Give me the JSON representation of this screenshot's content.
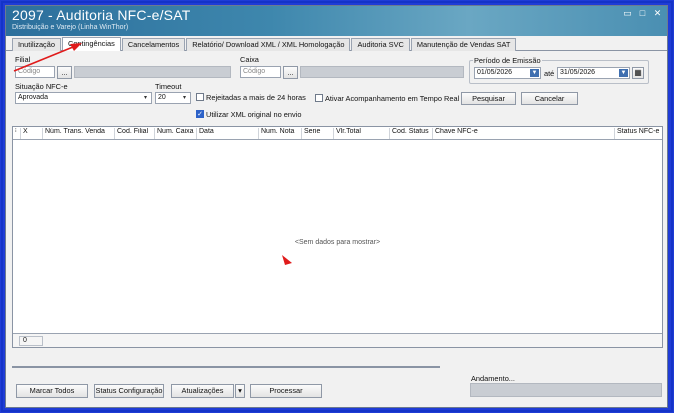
{
  "window": {
    "title": "2097 - Auditoria NFC-e/SAT",
    "subtitle": "Distribuição e Varejo (Linha WinThor)",
    "controls": [
      "restore-icon",
      "maximize-icon",
      "close-icon"
    ]
  },
  "tabs": [
    {
      "label": "Inutilização",
      "active": false
    },
    {
      "label": "Contingências",
      "active": true
    },
    {
      "label": "Cancelamentos",
      "active": false
    },
    {
      "label": "Relatório/ Download XML / XML Homologação",
      "active": false
    },
    {
      "label": "Auditoria SVC",
      "active": false
    },
    {
      "label": "Manutenção de Vendas SAT",
      "active": false
    }
  ],
  "filters": {
    "filial": {
      "label": "Filial",
      "placeholder": "Código",
      "lookup": "..."
    },
    "caixa": {
      "label": "Caixa",
      "placeholder": "Código",
      "lookup": "..."
    },
    "periodo": {
      "label": "Período de Emissão",
      "start": "01/05/2026",
      "separator": "até",
      "end": "31/05/2026",
      "calendar_icon": "calendar-icon"
    },
    "situacao": {
      "label": "Situação NFC-e",
      "value": "Aprovada"
    },
    "timeout": {
      "label": "Timeout",
      "value": "20"
    },
    "rejeitadas": {
      "label": "Rejeitadas a mais de 24 horas",
      "checked": false
    },
    "acompanhamento": {
      "label": "Ativar Acompanhamento em Tempo Real",
      "checked": false
    },
    "xml_original": {
      "label": "Utilizar XML original no envio",
      "checked": true
    }
  },
  "actions": {
    "pesquisar": "Pesquisar",
    "cancelar": "Cancelar"
  },
  "grid": {
    "columns": [
      "X",
      "Núm. Trans. Venda",
      "Cod. Filial",
      "Num. Caixa",
      "Data",
      "Num. Nota",
      "Serie",
      "Vlr.Total",
      "Cod. Status",
      "Chave NFC-e",
      "Status NFC-e"
    ],
    "empty_text": "<Sem dados para mostrar>",
    "footer_count": "0"
  },
  "bottom": {
    "marcar_todos": "Marcar Todos",
    "status_configuracao": "Status Configuração",
    "atualizacoes": "Atualizações",
    "processar": "Processar",
    "andamento_label": "Andamento..."
  },
  "colors": {
    "frame": "#1f3cd6",
    "annotation_arrow": "#e01b1b"
  }
}
